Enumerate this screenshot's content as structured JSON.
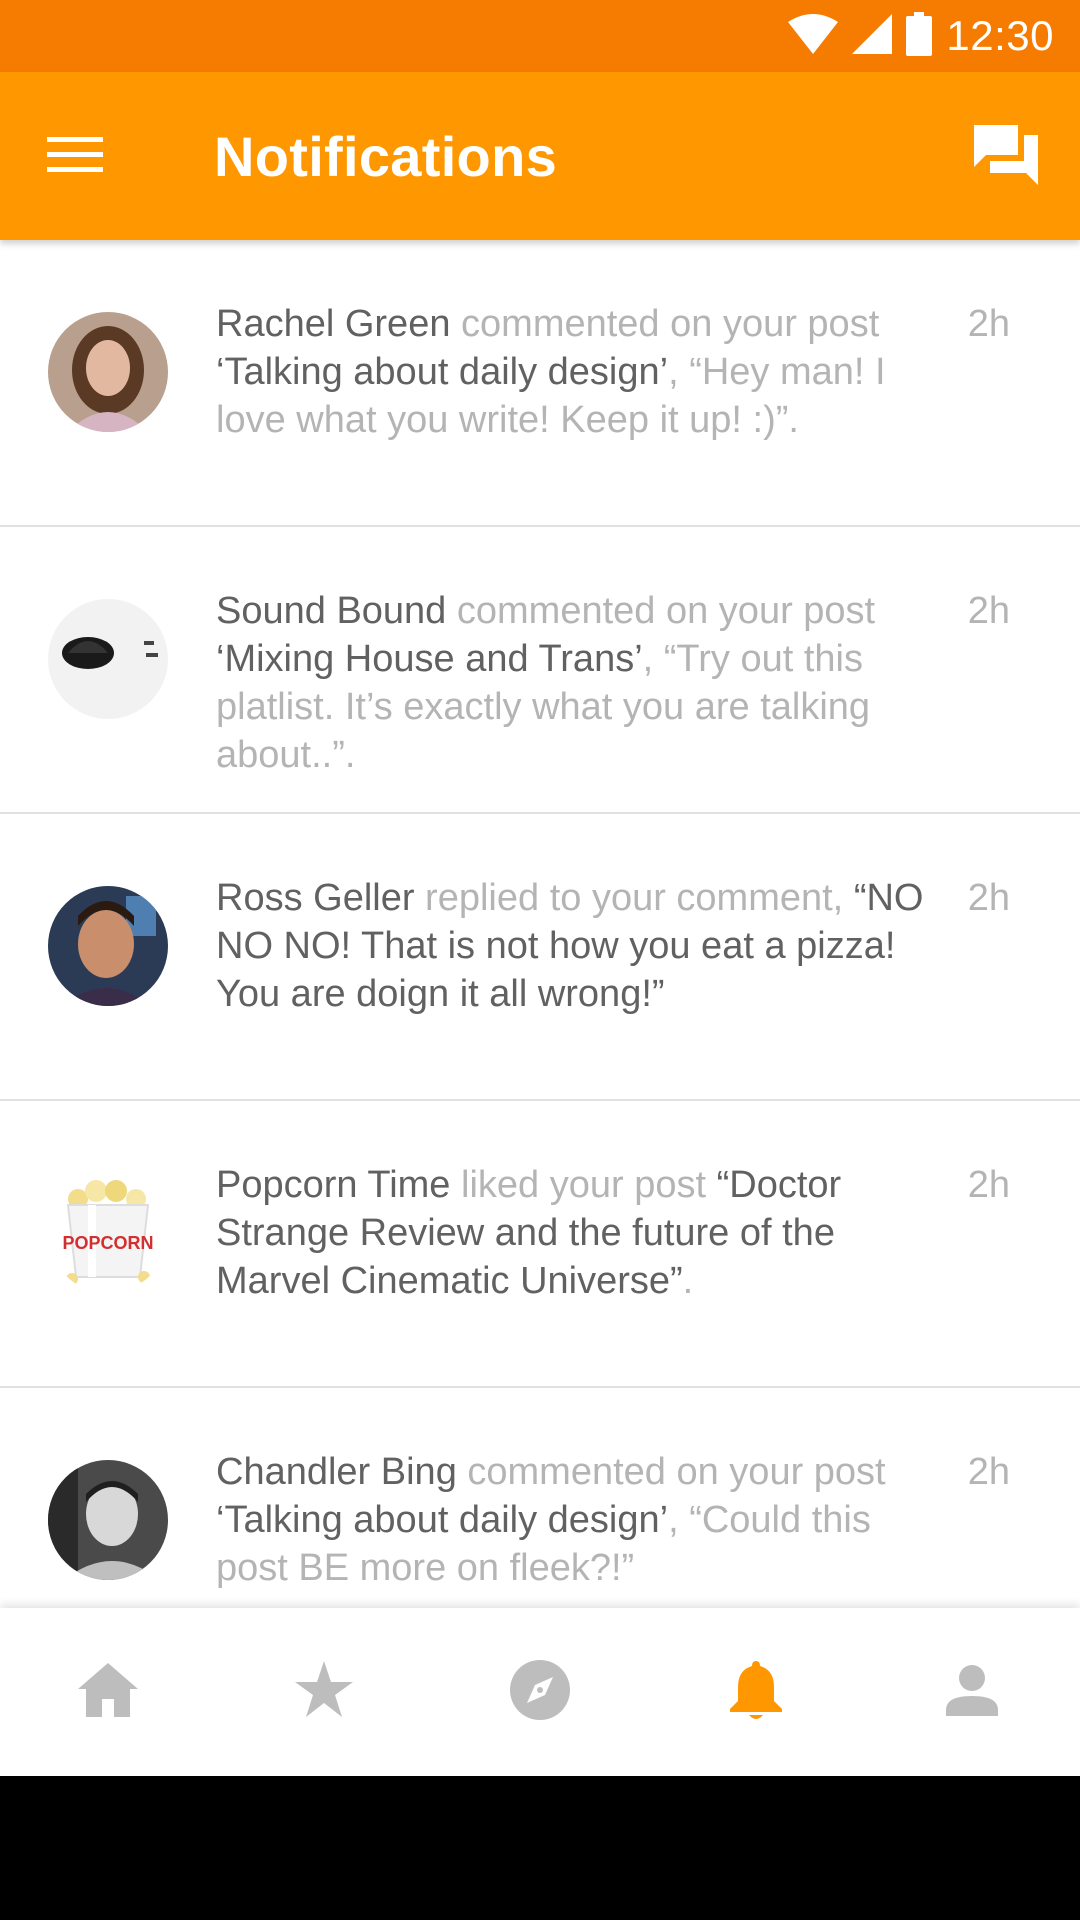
{
  "status_bar": {
    "time": "12:30"
  },
  "app_bar": {
    "title": "Notifications",
    "menu_icon": "menu-icon",
    "chat_icon": "chat-icon"
  },
  "colors": {
    "primary": "#FF9800",
    "primary_dark": "#F57C00",
    "text_dark": "#616161",
    "text_light": "#b4b4b4",
    "inactive_icon": "#bdbdbd",
    "active_icon": "#FF9800"
  },
  "notifications": [
    {
      "user": "Rachel Green",
      "action": " commented on your post ",
      "target": "‘Talking about daily design’",
      "tail": ", “Hey man! I love what you write! Keep it up! :)”.",
      "time": "2h"
    },
    {
      "user": "Sound Bound",
      "action": " commented on your post ",
      "target": "‘Mixing House and Trans’",
      "tail": ", “Try out this platlist. It’s exactly what you are talking about..”.",
      "time": "2h"
    },
    {
      "user": "Ross Geller",
      "action": " replied to your comment, ",
      "target": "“NO NO NO! That is not how you eat a pizza! You are doign it all wrong!”",
      "tail": "",
      "time": "2h"
    },
    {
      "user": "Popcorn Time",
      "action": " liked your post ",
      "target": "“Doctor Strange Review and the future of the Marvel Cinematic Universe”",
      "tail": ".",
      "time": "2h"
    },
    {
      "user": "Chandler Bing",
      "action": " commented on your post ",
      "target": "‘Talking about daily design’",
      "tail": ", “Could this post BE more on fleek?!”",
      "time": "2h"
    }
  ],
  "avatar_labels": {
    "popcorn": "POPCORN"
  },
  "bottom_nav": [
    "home-icon",
    "star-icon",
    "explore-icon",
    "notifications-icon",
    "person-icon"
  ],
  "bottom_nav_active": "notifications-icon"
}
